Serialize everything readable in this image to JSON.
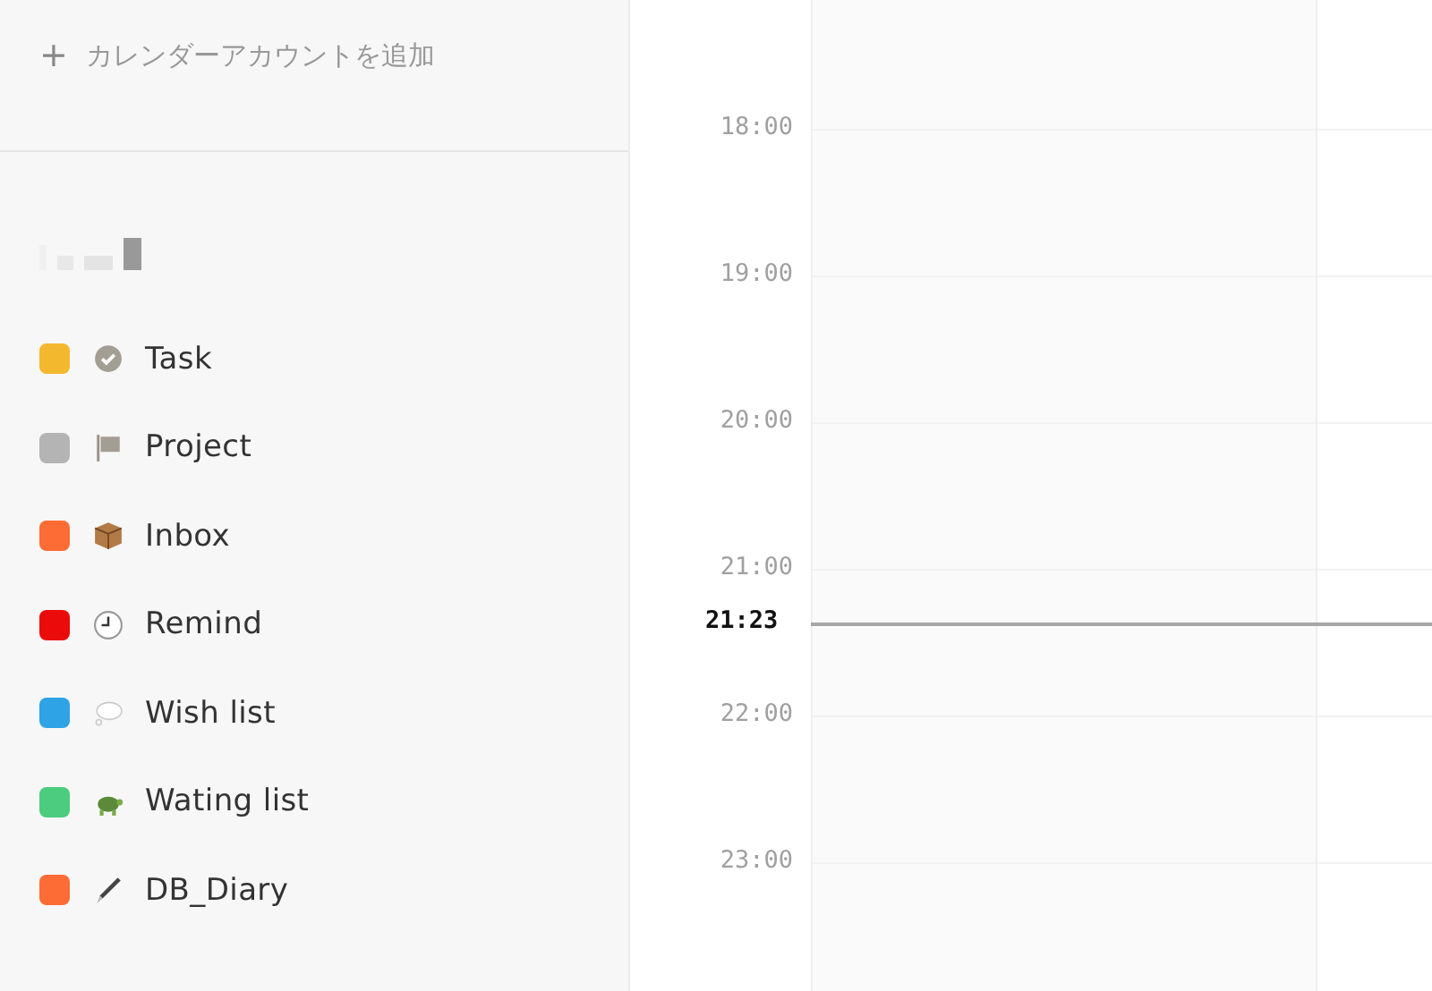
{
  "sidebar": {
    "add_account": {
      "icon_text": "+",
      "label": "カレンダーアカウントを追加"
    },
    "calendars": [
      {
        "name": "Task",
        "color": "#f4b82e"
      },
      {
        "name": "Project",
        "color": "#b4b4b4"
      },
      {
        "name": "Inbox",
        "color": "#fe6c36"
      },
      {
        "name": "Remind",
        "color": "#ec0b0b"
      },
      {
        "name": "Wish list",
        "color": "#2ea3e6"
      },
      {
        "name": "Wating list",
        "color": "#4ccc7e"
      },
      {
        "name": "DB_Diary",
        "color": "#fe6c36"
      }
    ]
  },
  "calendar": {
    "hours": [
      "18:00",
      "19:00",
      "20:00",
      "21:00",
      "22:00",
      "23:00"
    ],
    "now": "21:23"
  }
}
